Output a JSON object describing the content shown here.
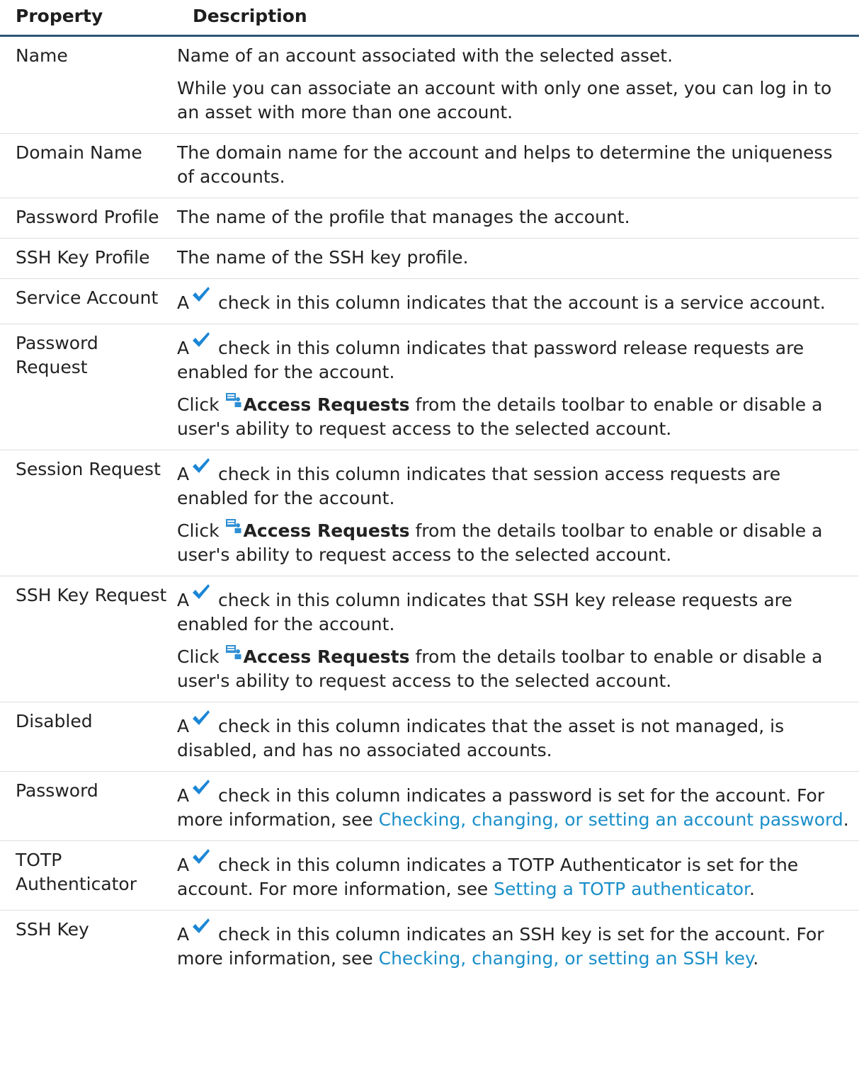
{
  "headers": {
    "property": "Property",
    "description": "Description"
  },
  "icons": {
    "check": "check-icon",
    "access_requests": "access-requests-icon"
  },
  "colors": {
    "header_rule": "#2c5577",
    "link": "#1a8fc9",
    "check": "#1b86d6"
  },
  "common": {
    "check_a": "A",
    "click": "Click",
    "access_requests": "Access Requests",
    "access_requests_rest": " from the details toolbar to enable or disable a user's ability to request access to the selected account.",
    "for_more_info": "For more information, see ",
    "period": "."
  },
  "rows": {
    "name": {
      "label": "Name",
      "p1": "Name of an account associated with the selected asset.",
      "p2": "While you can associate an account with only one asset, you can log in to an asset with more than one account."
    },
    "domain_name": {
      "label": "Domain Name",
      "p1": "The domain name for the account and helps to determine the uniqueness of accounts."
    },
    "password_profile": {
      "label": "Password Profile",
      "p1": "The name of the profile that manages the account."
    },
    "ssh_key_profile": {
      "label": "SSH Key Profile",
      "p1": "The name of the SSH key profile."
    },
    "service_account": {
      "label": "Service Account",
      "p1": " check in this column indicates that the account is a service account."
    },
    "password_request": {
      "label": "Password Request",
      "p1": " check in this column indicates that password release requests are enabled for the account."
    },
    "session_request": {
      "label": "Session Request",
      "p1": " check in this column indicates that session access requests are enabled for the account."
    },
    "ssh_key_request": {
      "label": "SSH Key Request",
      "p1": " check in this column indicates that SSH key release requests are enabled for the account."
    },
    "disabled": {
      "label": "Disabled",
      "p1": " check in this column indicates that the asset is not managed, is disabled, and has no associated accounts."
    },
    "password": {
      "label": "Password",
      "p1": " check in this column indicates a password is set for the account. ",
      "link": "Checking, changing, or setting an account password"
    },
    "totp": {
      "label": "TOTP Authenticator",
      "p1": " check in this column indicates a TOTP Authenticator is set for the account. ",
      "link": "Setting a TOTP authenticator"
    },
    "ssh_key": {
      "label": "SSH Key",
      "p1": " check in this column indicates an SSH key is set for the account. ",
      "link": "Checking, changing, or setting an SSH key"
    }
  }
}
